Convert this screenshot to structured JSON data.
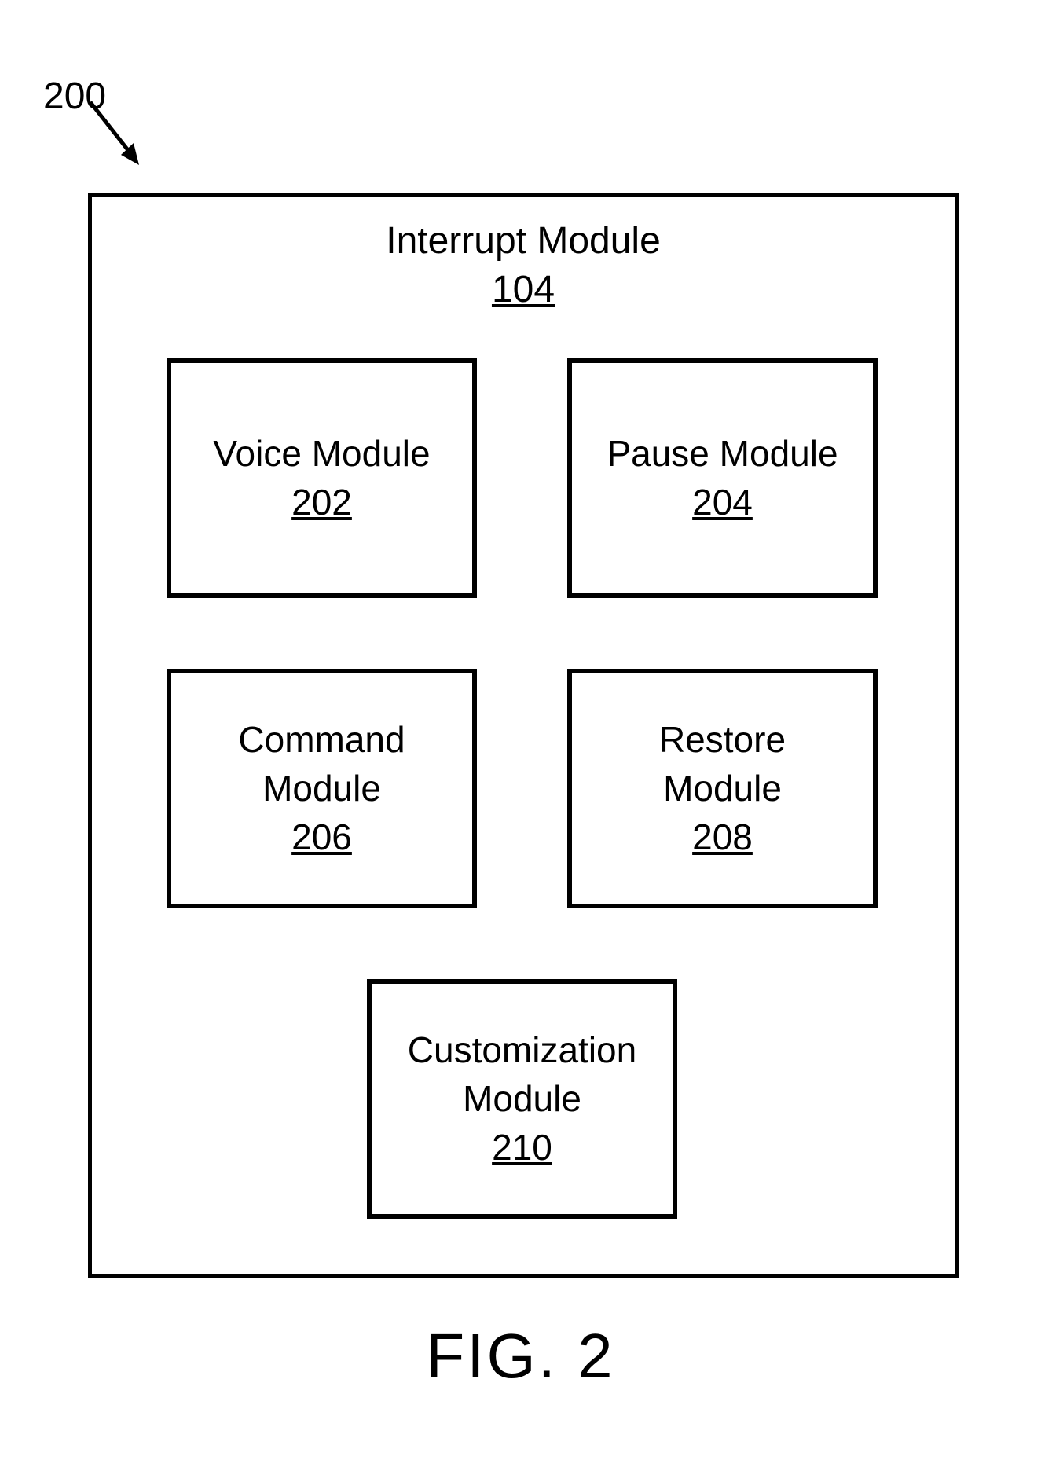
{
  "figure_number": "200",
  "outer_module": {
    "title": "Interrupt Module",
    "ref": "104"
  },
  "modules": {
    "voice": {
      "title": "Voice Module",
      "ref": "202"
    },
    "pause": {
      "title": "Pause Module",
      "ref": "204"
    },
    "command": {
      "title_line1": "Command",
      "title_line2": "Module",
      "ref": "206"
    },
    "restore": {
      "title_line1": "Restore",
      "title_line2": "Module",
      "ref": "208"
    },
    "customization": {
      "title_line1": "Customization",
      "title_line2": "Module",
      "ref": "210"
    }
  },
  "figure_caption": "FIG. 2"
}
